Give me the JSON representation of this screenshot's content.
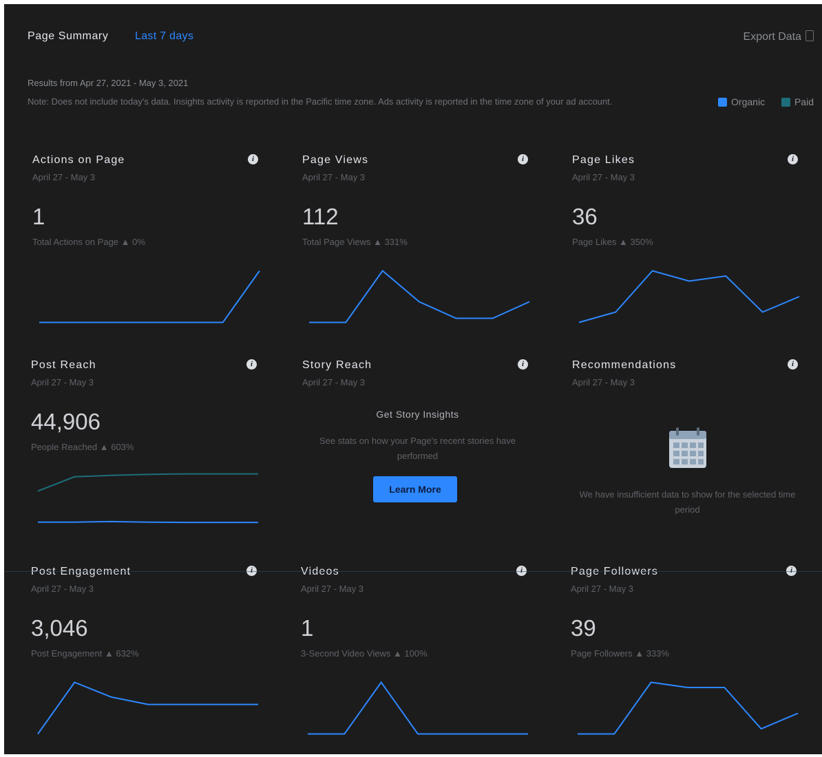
{
  "header": {
    "title": "Page Summary",
    "range": "Last 7 days",
    "export_label": "Export Data"
  },
  "results_text": "Results from Apr 27, 2021 - May 3, 2021",
  "note_text": "Note: Does not include today's data. Insights activity is reported in the Pacific time zone. Ads activity is reported in the time zone of your ad account.",
  "legend": {
    "organic": "Organic",
    "paid": "Paid",
    "organic_color": "#2d88ff",
    "paid_color": "#1d6e7a"
  },
  "cards": {
    "actions": {
      "title": "Actions on Page",
      "dates": "April 27 - May 3",
      "value": "1",
      "sub": "Total Actions on Page ▲ 0%"
    },
    "views": {
      "title": "Page Views",
      "dates": "April 27 - May 3",
      "value": "112",
      "sub": "Total Page Views ▲ 331%"
    },
    "likes": {
      "title": "Page Likes",
      "dates": "April 27 - May 3",
      "value": "36",
      "sub": "Page Likes ▲ 350%"
    },
    "reach": {
      "title": "Post Reach",
      "dates": "April 27 - May 3",
      "value": "44,906",
      "sub": "People Reached ▲ 603%"
    },
    "story": {
      "title": "Story Reach",
      "dates": "April 27 - May 3",
      "heading": "Get Story Insights",
      "desc": "See stats on how your Page's recent stories have performed",
      "button": "Learn More"
    },
    "recs": {
      "title": "Recommendations",
      "dates": "April 27 - May 3",
      "text": "We have insufficient data to show for the selected time period"
    },
    "engagement": {
      "title": "Post Engagement",
      "dates": "April 27 - May 3",
      "value": "3,046",
      "sub": "Post Engagement ▲ 632%"
    },
    "videos": {
      "title": "Videos",
      "dates": "April 27 - May 3",
      "value": "1",
      "sub": "3-Second Video Views ▲ 100%"
    },
    "followers": {
      "title": "Page Followers",
      "dates": "April 27 - May 3",
      "value": "39",
      "sub": "Page Followers ▲ 333%"
    }
  },
  "sparklines": {
    "actions": [
      0,
      0,
      0,
      0,
      0,
      0,
      1
    ],
    "views": [
      10,
      10,
      35,
      20,
      12,
      12,
      20
    ],
    "likes": [
      2,
      4,
      12,
      10,
      11,
      4,
      7
    ],
    "reach_paid": [
      16000,
      21000,
      21500,
      21800,
      22000,
      22000,
      22000
    ],
    "reach_organic": [
      5200,
      5200,
      5400,
      5200,
      5100,
      5100,
      5100
    ],
    "engagement": [
      200,
      900,
      700,
      600,
      600,
      600,
      600
    ],
    "videos": [
      0,
      0,
      1,
      0,
      0,
      0,
      0
    ],
    "followers": [
      2,
      2,
      12,
      11,
      11,
      3,
      6
    ]
  }
}
